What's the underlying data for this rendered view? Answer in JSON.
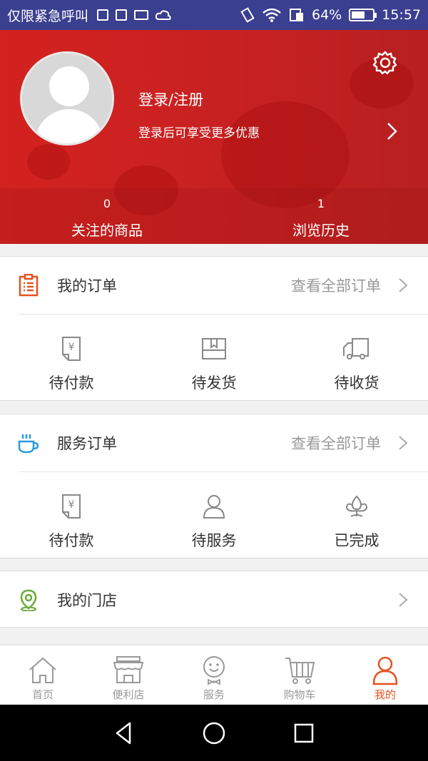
{
  "status_bar": {
    "carrier": "仅限紧急呼叫",
    "battery_text": "64%",
    "battery_level": 0.64,
    "time": "15:57"
  },
  "profile": {
    "login_title": "登录/注册",
    "login_subtitle": "登录后可享受更多优惠",
    "stats": [
      {
        "count": "0",
        "label": "关注的商品"
      },
      {
        "count": "1",
        "label": "浏览历史"
      }
    ]
  },
  "my_orders": {
    "title": "我的订单",
    "more": "查看全部订单",
    "items": [
      {
        "label": "待付款",
        "icon": "yuan-receipt-icon"
      },
      {
        "label": "待发货",
        "icon": "package-box-icon"
      },
      {
        "label": "待收货",
        "icon": "delivery-truck-icon"
      }
    ]
  },
  "service_orders": {
    "title": "服务订单",
    "more": "查看全部订单",
    "items": [
      {
        "label": "待付款",
        "icon": "yuan-receipt-icon"
      },
      {
        "label": "待服务",
        "icon": "person-icon"
      },
      {
        "label": "已完成",
        "icon": "flower-icon"
      }
    ]
  },
  "my_store": {
    "title": "我的门店"
  },
  "bottom_nav": [
    {
      "label": "首页",
      "icon": "home-icon"
    },
    {
      "label": "便利店",
      "icon": "store-icon"
    },
    {
      "label": "服务",
      "icon": "service-face-icon"
    },
    {
      "label": "购物车",
      "icon": "cart-icon"
    },
    {
      "label": "我的",
      "icon": "user-icon",
      "active": true
    }
  ],
  "colors": {
    "header_red": "#d32220",
    "accent_orange": "#e5521f",
    "service_blue": "#2a9be0",
    "store_green": "#6aab3c",
    "status_bar": "#3a3f8f"
  }
}
